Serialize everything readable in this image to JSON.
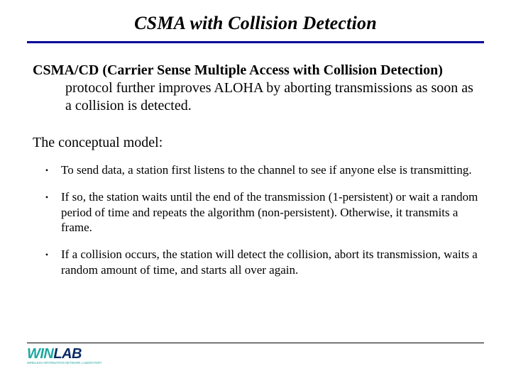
{
  "title": "CSMA with Collision Detection",
  "intro": {
    "bold_span": "CSMA/CD (Carrier Sense Multiple Access with Collision Detection)",
    "rest": " protocol further improves ALOHA by aborting transmissions as soon as a collision is detected."
  },
  "model_heading": "The conceptual model:",
  "bullets": [
    "To send data, a station first listens to the channel to see if anyone else is transmitting.",
    "If so, the station waits until the end of the transmission (1-persistent) or wait a random period of time and repeats the algorithm (non-persistent). Otherwise, it transmits a frame.",
    "If a collision occurs, the station will detect the collision, abort its transmission, waits a random amount of time, and starts all over again."
  ],
  "logo": {
    "teal": "WIN",
    "navy": "LAB",
    "sub": "WIRELESS INFORMATION NETWORK LABORATORY"
  },
  "colors": {
    "rule": "#000099",
    "logo_teal": "#1fa8a0",
    "logo_navy": "#0a2a66"
  }
}
